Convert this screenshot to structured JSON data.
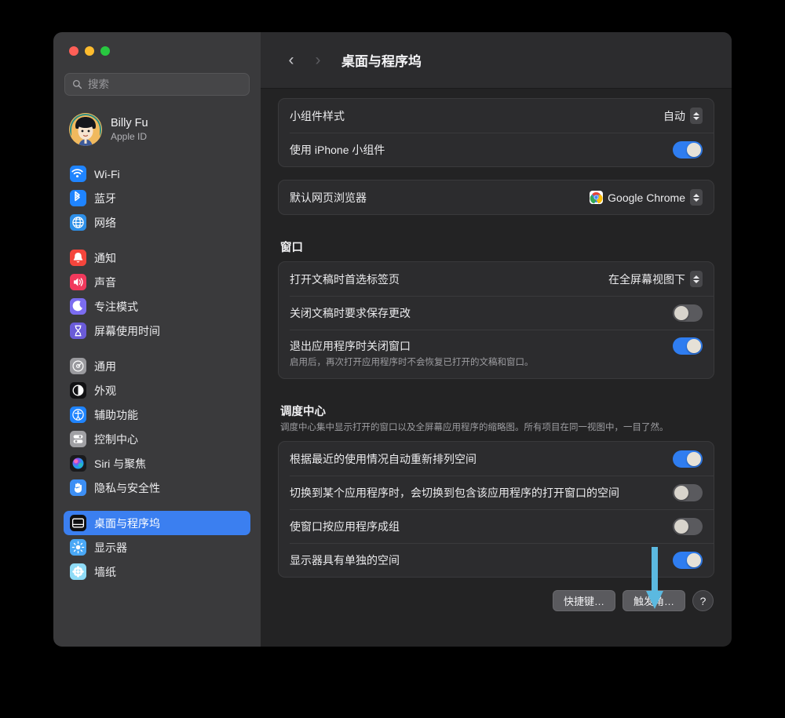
{
  "window": {
    "traffic_lights": [
      "close",
      "minimize",
      "zoom"
    ],
    "colors": {
      "accent": "#3b7ff0",
      "toggle_on": "#2f7df0",
      "annotation_arrow": "#5bb9e0",
      "sidebar_bg": "#3a3a3c",
      "detail_bg": "#232324"
    }
  },
  "sidebar": {
    "search": {
      "placeholder": "搜索",
      "value": ""
    },
    "account": {
      "name": "Billy Fu",
      "subtitle": "Apple ID"
    },
    "groups": [
      {
        "items": [
          {
            "label": "Wi-Fi",
            "icon": "wifi-icon",
            "selected": false
          },
          {
            "label": "蓝牙",
            "icon": "bluetooth-icon",
            "selected": false
          },
          {
            "label": "网络",
            "icon": "network-globe-icon",
            "selected": false
          }
        ]
      },
      {
        "items": [
          {
            "label": "通知",
            "icon": "notifications-bell-icon",
            "selected": false
          },
          {
            "label": "声音",
            "icon": "sound-speaker-icon",
            "selected": false
          },
          {
            "label": "专注模式",
            "icon": "focus-moon-icon",
            "selected": false
          },
          {
            "label": "屏幕使用时间",
            "icon": "screen-time-hourglass-icon",
            "selected": false
          }
        ]
      },
      {
        "items": [
          {
            "label": "通用",
            "icon": "general-gear-icon",
            "selected": false
          },
          {
            "label": "外观",
            "icon": "appearance-contrast-icon",
            "selected": false
          },
          {
            "label": "辅助功能",
            "icon": "accessibility-icon",
            "selected": false
          },
          {
            "label": "控制中心",
            "icon": "control-center-icon",
            "selected": false
          },
          {
            "label": "Siri 与聚焦",
            "icon": "siri-icon",
            "selected": false
          },
          {
            "label": "隐私与安全性",
            "icon": "privacy-hand-icon",
            "selected": false
          }
        ]
      },
      {
        "items": [
          {
            "label": "桌面与程序坞",
            "icon": "desktop-dock-icon",
            "selected": true
          },
          {
            "label": "显示器",
            "icon": "displays-brightness-icon",
            "selected": false
          },
          {
            "label": "墙纸",
            "icon": "wallpaper-flower-icon",
            "selected": false
          }
        ]
      }
    ]
  },
  "detail": {
    "nav": {
      "back": "‹",
      "forward": "›",
      "forward_disabled": true
    },
    "title": "桌面与程序坞",
    "cards": [
      {
        "rows": [
          {
            "label": "小组件样式",
            "control": "popup",
            "value": "自动"
          },
          {
            "label": "使用 iPhone 小组件",
            "control": "toggle",
            "on": true
          }
        ]
      },
      {
        "rows": [
          {
            "label": "默认网页浏览器",
            "control": "popup-icon",
            "value": "Google Chrome",
            "icon": "chrome-icon"
          }
        ]
      }
    ],
    "window_section": {
      "heading": "窗口",
      "rows": [
        {
          "label": "打开文稿时首选标签页",
          "control": "popup",
          "value": "在全屏幕视图下"
        },
        {
          "label": "关闭文稿时要求保存更改",
          "control": "toggle",
          "on": false
        },
        {
          "label": "退出应用程序时关闭窗口",
          "control": "toggle",
          "on": true,
          "sub": "启用后，再次打开应用程序时不会恢复已打开的文稿和窗口。"
        }
      ]
    },
    "mission_control_section": {
      "heading": "调度中心",
      "description": "调度中心集中显示打开的窗口以及全屏幕应用程序的缩略图。所有项目在同一视图中，一目了然。",
      "rows": [
        {
          "label": "根据最近的使用情况自动重新排列空间",
          "control": "toggle",
          "on": true
        },
        {
          "label": "切换到某个应用程序时，会切换到包含该应用程序的打开窗口的空间",
          "control": "toggle",
          "on": false
        },
        {
          "label": "使窗口按应用程序成组",
          "control": "toggle",
          "on": false
        },
        {
          "label": "显示器具有单独的空间",
          "control": "toggle",
          "on": true
        }
      ]
    },
    "buttons": [
      {
        "label": "快捷键…",
        "name": "keyboard-shortcuts-button"
      },
      {
        "label": "触发角…",
        "name": "hot-corners-button"
      },
      {
        "label": "?",
        "name": "help-button"
      }
    ]
  },
  "annotation": {
    "type": "arrow-down",
    "points_to": "触发角…",
    "color": "#5bb9e0"
  }
}
